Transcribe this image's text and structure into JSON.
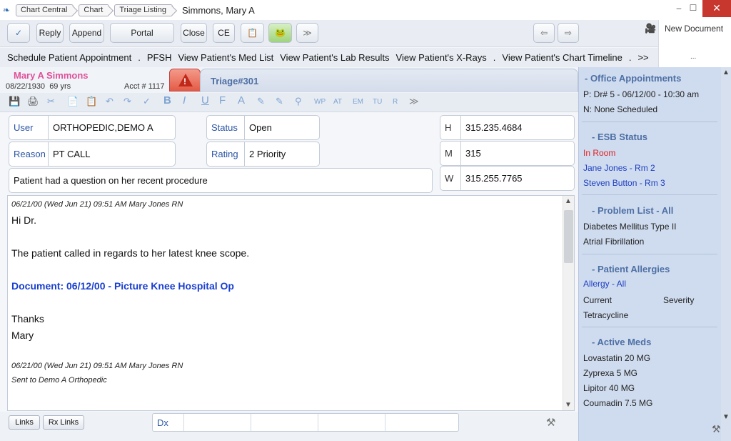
{
  "titlebar": {
    "crumbs": [
      "Chart Central",
      "Chart",
      "Triage Listing"
    ],
    "title": "Simmons, Mary A",
    "minimize": "–",
    "maximize": "☐",
    "close": "✕"
  },
  "toolbar": {
    "check_icon": "✓",
    "reply": "Reply",
    "append": "Append",
    "portal": "Portal Messages",
    "close": "Close",
    "ce": "CE",
    "clipboard_icon": "📋",
    "frog_icon": "🐸",
    "forward_icon": "≫",
    "back_arrow": "⇦",
    "fwd_arrow": "⇨",
    "new_document": "New Document",
    "more": "..."
  },
  "actions": [
    "Schedule Patient Appointment",
    ".",
    "PFSH",
    "View Patient's Med List",
    "View Patient's Lab Results",
    "View Patient's X-Rays",
    ".",
    "View Patient's Chart Timeline",
    ".",
    ">>"
  ],
  "patient": {
    "name": "Mary A Simmons",
    "dob": "08/22/1930",
    "age": "69 yrs",
    "acct": "Acct # 1117",
    "tab": "Triage#301"
  },
  "format_toolbar": [
    "💾",
    "🖨",
    "✂",
    "📄",
    "📋",
    "↶",
    "↷",
    "✓",
    "B",
    "I",
    "U",
    "F",
    "A",
    "✎",
    "✎",
    "⚲",
    "WP",
    "AT",
    "EM",
    "TU",
    "R",
    "≫"
  ],
  "fields": {
    "user_label": "User",
    "user_value": "ORTHOPEDIC,DEMO A",
    "status_label": "Status",
    "status_value": "Open",
    "reason_label": "Reason",
    "reason_value": "PT CALL",
    "rating_label": "Rating",
    "rating_value": "2 Priority",
    "summary": "Patient had a question on her recent procedure",
    "phone_h_label": "H",
    "phone_h": "315.235.4684",
    "phone_m_label": "M",
    "phone_m": "315",
    "phone_w_label": "W",
    "phone_w": "315.255.7765"
  },
  "notes": {
    "meta1": "06/21/00 (Wed Jun 21) 09:51 AM  Mary Jones RN",
    "greeting": "Hi  Dr.",
    "line1": "The patient called in regards to her latest knee scope.",
    "doc_link": "Document: 06/12/00 - Picture Knee Hospital Op",
    "thanks": "Thanks",
    "sign": "Mary",
    "meta2": "06/21/00 (Wed Jun 21) 09:51 AM  Mary Jones RN",
    "sent": "Sent to Demo A Orthopedic"
  },
  "bottom": {
    "links": "Links",
    "rx_links": "Rx Links",
    "dx": "Dx"
  },
  "right_panel": {
    "appts_title": "- Office Appointments",
    "appt_p": "P: Dr# 5 - 06/12/00 - 10:30 am",
    "appt_n": "N: None Scheduled",
    "esb_title": "- ESB Status",
    "esb_in_room": "In Room",
    "esb_1": "Jane Jones - Rm 2",
    "esb_2": "Steven Button - Rm 3",
    "problems_title": "- Problem List - All",
    "problem_1": "Diabetes Mellitus Type II",
    "problem_2": "Atrial Fibrillation",
    "allergies_title": "- Patient Allergies",
    "allergy_filter": "Allergy - All",
    "allergy_col_current": "Current",
    "allergy_col_severity": "Severity",
    "allergy_1": "Tetracycline",
    "meds_title": "- Active Meds",
    "med_1": "Lovastatin 20 MG",
    "med_2": "Zyprexa 5 MG",
    "med_3": "Lipitor 40 MG",
    "med_4": "Coumadin 7.5 MG"
  },
  "colors": {
    "accent": "#4e6fa4",
    "patient_name": "#e0509a",
    "alert": "#e35b45",
    "link": "#1a3fcf"
  }
}
